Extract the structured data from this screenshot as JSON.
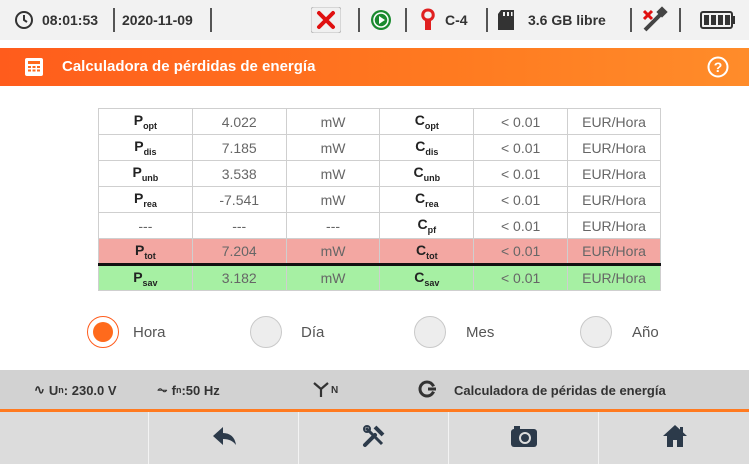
{
  "status": {
    "time": "08:01:53",
    "date": "2020-11-09",
    "channel": "C-4",
    "memory": "3.6 GB libre"
  },
  "title": "Calculadora de pérdidas de energía",
  "table": {
    "rows": [
      {
        "p_main": "P",
        "p_sub": "opt",
        "p_val": "4.022",
        "p_unit": "mW",
        "c_main": "C",
        "c_sub": "opt",
        "c_val": "< 0.01",
        "c_unit": "EUR/Hora"
      },
      {
        "p_main": "P",
        "p_sub": "dis",
        "p_val": "7.185",
        "p_unit": "mW",
        "c_main": "C",
        "c_sub": "dis",
        "c_val": "< 0.01",
        "c_unit": "EUR/Hora"
      },
      {
        "p_main": "P",
        "p_sub": "unb",
        "p_val": "3.538",
        "p_unit": "mW",
        "c_main": "C",
        "c_sub": "unb",
        "c_val": "< 0.01",
        "c_unit": "EUR/Hora"
      },
      {
        "p_main": "P",
        "p_sub": "rea",
        "p_val": "-7.541",
        "p_unit": "mW",
        "c_main": "C",
        "c_sub": "rea",
        "c_val": "< 0.01",
        "c_unit": "EUR/Hora"
      },
      {
        "p_main": "---",
        "p_sub": "",
        "p_val": "---",
        "p_unit": "---",
        "c_main": "C",
        "c_sub": "pf",
        "c_val": "< 0.01",
        "c_unit": "EUR/Hora"
      },
      {
        "p_main": "P",
        "p_sub": "tot",
        "p_val": "7.204",
        "p_unit": "mW",
        "c_main": "C",
        "c_sub": "tot",
        "c_val": "< 0.01",
        "c_unit": "EUR/Hora"
      },
      {
        "p_main": "P",
        "p_sub": "sav",
        "p_val": "3.182",
        "p_unit": "mW",
        "c_main": "C",
        "c_sub": "sav",
        "c_val": "< 0.01",
        "c_unit": "EUR/Hora"
      }
    ]
  },
  "periods": {
    "hour": "Hora",
    "day": "Día",
    "month": "Mes",
    "year": "Año",
    "selected": "Hora"
  },
  "infobar": {
    "u_label": "U",
    "u_sub": "n",
    "u_value": ": 230.0 V",
    "f_label": "f",
    "f_sub": "n",
    "f_value": ":50 Hz",
    "network_sub": "N",
    "calc_label": "Calculadora de péridas de energía"
  },
  "colors": {
    "accent": "#ff6a1c",
    "tot_row": "#f3a7a2",
    "sav_row": "#a6f0a3"
  }
}
